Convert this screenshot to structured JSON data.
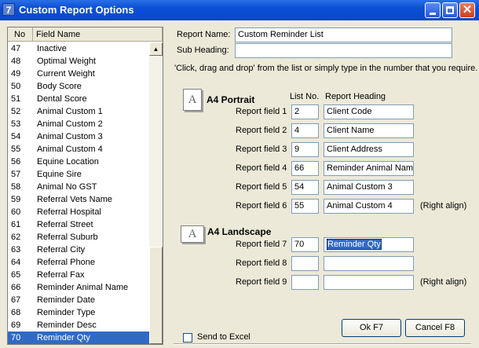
{
  "window": {
    "title": "Custom Report Options",
    "app_icon_glyph": "7"
  },
  "list": {
    "col_no": "No",
    "col_name": "Field Name",
    "rows": [
      {
        "no": "47",
        "name": "Inactive"
      },
      {
        "no": "48",
        "name": "Optimal Weight"
      },
      {
        "no": "49",
        "name": "Current Weight"
      },
      {
        "no": "50",
        "name": "Body Score"
      },
      {
        "no": "51",
        "name": "Dental Score"
      },
      {
        "no": "52",
        "name": "Animal Custom 1"
      },
      {
        "no": "53",
        "name": "Animal Custom 2"
      },
      {
        "no": "54",
        "name": "Animal Custom 3"
      },
      {
        "no": "55",
        "name": "Animal Custom 4"
      },
      {
        "no": "56",
        "name": "Equine Location"
      },
      {
        "no": "57",
        "name": "Equine Sire"
      },
      {
        "no": "58",
        "name": "Animal No GST"
      },
      {
        "no": "59",
        "name": "Referral Vets Name"
      },
      {
        "no": "60",
        "name": "Referral Hospital"
      },
      {
        "no": "61",
        "name": "Referral Street"
      },
      {
        "no": "62",
        "name": "Referral Suburb"
      },
      {
        "no": "63",
        "name": "Referral City"
      },
      {
        "no": "64",
        "name": "Referral Phone"
      },
      {
        "no": "65",
        "name": "Referral Fax"
      },
      {
        "no": "66",
        "name": "Reminder Animal Name"
      },
      {
        "no": "67",
        "name": "Reminder Date"
      },
      {
        "no": "68",
        "name": "Reminder Type"
      },
      {
        "no": "69",
        "name": "Reminder Desc"
      },
      {
        "no": "70",
        "name": "Reminder Qty"
      }
    ],
    "selected_no": "70"
  },
  "form": {
    "report_name_label": "Report Name:",
    "report_name_value": "Custom Reminder List",
    "sub_heading_label": "Sub Heading:",
    "sub_heading_value": "",
    "instruction": "'Click, drag and drop' from the list or simply type in the number that you require.",
    "col_list_no": "List No.",
    "col_report_heading": "Report Heading",
    "portrait": {
      "icon_glyph": "A",
      "title": "A4 Portrait",
      "fields": [
        {
          "label": "Report field 1",
          "list_no": "2",
          "heading": "Client Code",
          "note": ""
        },
        {
          "label": "Report field 2",
          "list_no": "4",
          "heading": "Client Name",
          "note": ""
        },
        {
          "label": "Report field 3",
          "list_no": "9",
          "heading": "Client Address",
          "note": ""
        },
        {
          "label": "Report field 4",
          "list_no": "66",
          "heading": "Reminder Animal Name",
          "note": ""
        },
        {
          "label": "Report field 5",
          "list_no": "54",
          "heading": "Animal Custom 3",
          "note": ""
        },
        {
          "label": "Report field 6",
          "list_no": "55",
          "heading": "Animal Custom 4",
          "note": "(Right align)"
        }
      ]
    },
    "landscape": {
      "icon_glyph": "A",
      "title": "A4 Landscape",
      "fields": [
        {
          "label": "Report field 7",
          "list_no": "70",
          "heading": "Reminder Qty",
          "note": ""
        },
        {
          "label": "Report field 8",
          "list_no": "",
          "heading": "",
          "note": ""
        },
        {
          "label": "Report field 9",
          "list_no": "",
          "heading": "",
          "note": "(Right align)"
        }
      ]
    },
    "send_to_excel_label": "Send to Excel",
    "send_to_excel_checked": false,
    "ok_label": "Ok F7",
    "cancel_label": "Cancel F8"
  }
}
